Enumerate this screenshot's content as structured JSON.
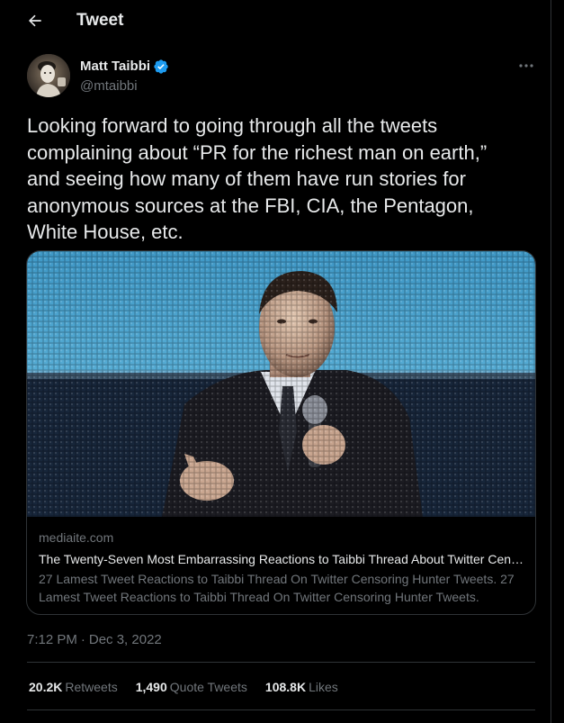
{
  "header": {
    "title": "Tweet",
    "back_icon": "arrow-left-icon"
  },
  "author": {
    "display_name": "Matt Taibbi",
    "handle": "@mtaibbi",
    "verified": true,
    "verified_color": "#1d9bf0"
  },
  "tweet": {
    "text": "Looking forward to going through all the tweets\ncomplaining about “PR for the richest man on earth,”\nand seeing how many of them have run stories for\nanonymous sources at the FBI, CIA, the Pentagon,\nWhite House, etc."
  },
  "card": {
    "domain": "mediaite.com",
    "title": "The Twenty-Seven Most Embarrassing Reactions to Taibbi Thread About Twitter Censoring Hunter Biden Story",
    "description": "27 Lamest Tweet Reactions to Taibbi Thread On Twitter Censoring Hunter Tweets. 27 Lamest Tweet Reactions to Taibbi Thread On Twitter Censoring Hunter Tweets."
  },
  "meta": {
    "time": "7:12 PM",
    "separator": "·",
    "date": "Dec 3, 2022"
  },
  "stats": {
    "retweets_count": "20.2K",
    "retweets_label": "Retweets",
    "quotes_count": "1,490",
    "quotes_label": "Quote Tweets",
    "likes_count": "108.8K",
    "likes_label": "Likes"
  },
  "colors": {
    "background": "#000000",
    "text_primary": "#e7e9ea",
    "text_secondary": "#71767b",
    "border": "#2f3336",
    "accent": "#1d9bf0"
  }
}
